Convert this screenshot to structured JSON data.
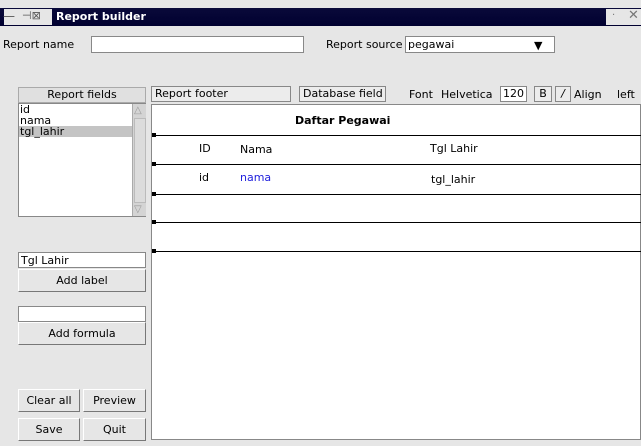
{
  "window": {
    "title": "Report builder"
  },
  "report_name": {
    "label": "Report name",
    "value": ""
  },
  "report_source": {
    "label": "Report source",
    "value": "pegawai"
  },
  "fields_panel": {
    "header": "Report fields",
    "items": [
      "id",
      "nama",
      "tgl_lahir"
    ],
    "selected_index": 2
  },
  "label_input": {
    "value": "Tgl Lahir"
  },
  "add_label": "Add label",
  "formula_input": {
    "value": ""
  },
  "add_formula": "Add formula",
  "buttons": {
    "clear_all": "Clear all",
    "preview": "Preview",
    "save": "Save",
    "quit": "Quit"
  },
  "toolbar": {
    "section": "Report footer",
    "field_type": "Database field",
    "font_label": "Font",
    "font_name": "Helvetica",
    "font_size": "120",
    "bold": "B",
    "italic": "/",
    "align_label": "Align",
    "align_value": "left"
  },
  "report": {
    "title": "Daftar Pegawai",
    "headers": [
      "ID",
      "Nama",
      "Tgl Lahir"
    ],
    "fields": [
      "id",
      "nama",
      "tgl_lahir"
    ]
  },
  "colors": {
    "field_link": "#2222dd",
    "titlebar": "#000030"
  }
}
